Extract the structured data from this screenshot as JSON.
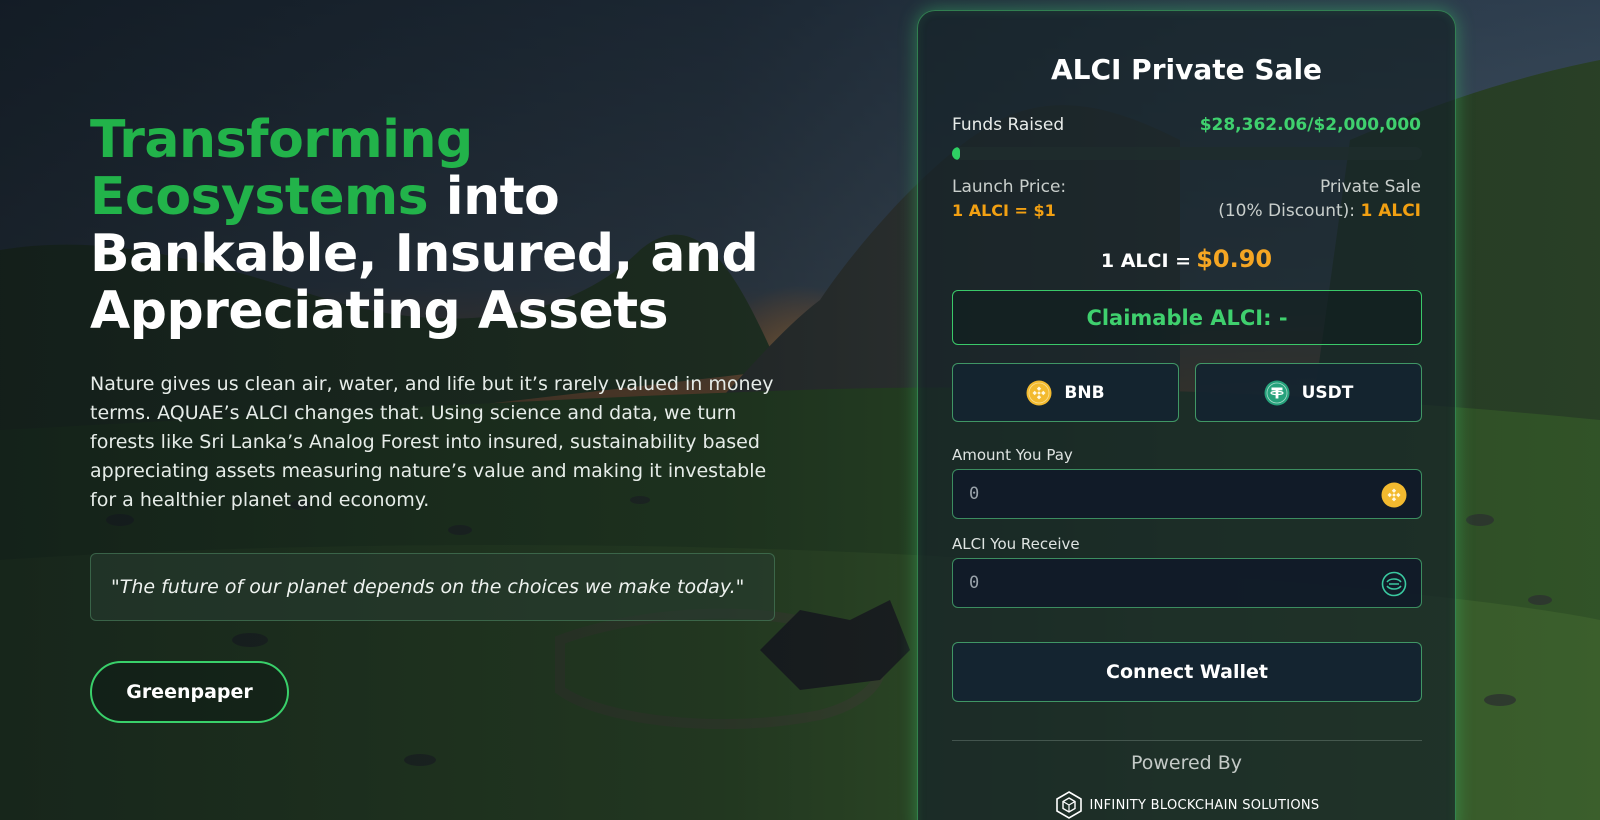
{
  "hero": {
    "title_accent_1": "Transforming",
    "title_accent_2": "Ecosystems",
    "title_plain_1": " into",
    "title_plain_2": "Bankable, Insured, and",
    "title_plain_3": "Appreciating Assets",
    "description": "Nature gives us clean air, water, and life but it’s rarely valued in money terms. AQUAE’s ALCI changes that. Using science and data, we turn forests like Sri Lanka’s Analog Forest into insured, sustainability based appreciating assets measuring nature’s value and making it investable for a healthier planet and economy.",
    "quote": "\"The future of our planet depends on the choices we make today.\"",
    "greenpaper_label": "Greenpaper"
  },
  "sale": {
    "title": "ALCI Private Sale",
    "funds_label": "Funds Raised",
    "funds_value": "$28,362.06/$2,000,000",
    "progress_fraction": 0.014,
    "launch_label": "Launch Price:",
    "launch_value": "1 ALCI = $1",
    "private_label": "Private Sale",
    "private_sub": "(10% Discount):",
    "private_value": "1 ALCI",
    "rate_prefix": "1 ALCI =",
    "rate_value": "$0.90",
    "claimable": "Claimable ALCI: -",
    "bnb_label": "BNB",
    "usdt_label": "USDT",
    "pay_label": "Amount You Pay",
    "pay_placeholder": "0",
    "receive_label": "ALCI You Receive",
    "receive_placeholder": "0",
    "connect_label": "Connect Wallet",
    "powered_by": "Powered By",
    "brand": "INFINITY BLOCKCHAIN SOLUTIONS"
  },
  "colors": {
    "accent_green": "#22b34a",
    "value_green": "#3fd06e",
    "price_orange": "#f2a012",
    "bnb_yellow": "#f3ba2f",
    "usdt_teal": "#26a17b"
  },
  "icons": [
    "bnb-coin-icon",
    "usdt-coin-icon",
    "alci-token-icon",
    "infinity-blockchain-logo-icon"
  ]
}
